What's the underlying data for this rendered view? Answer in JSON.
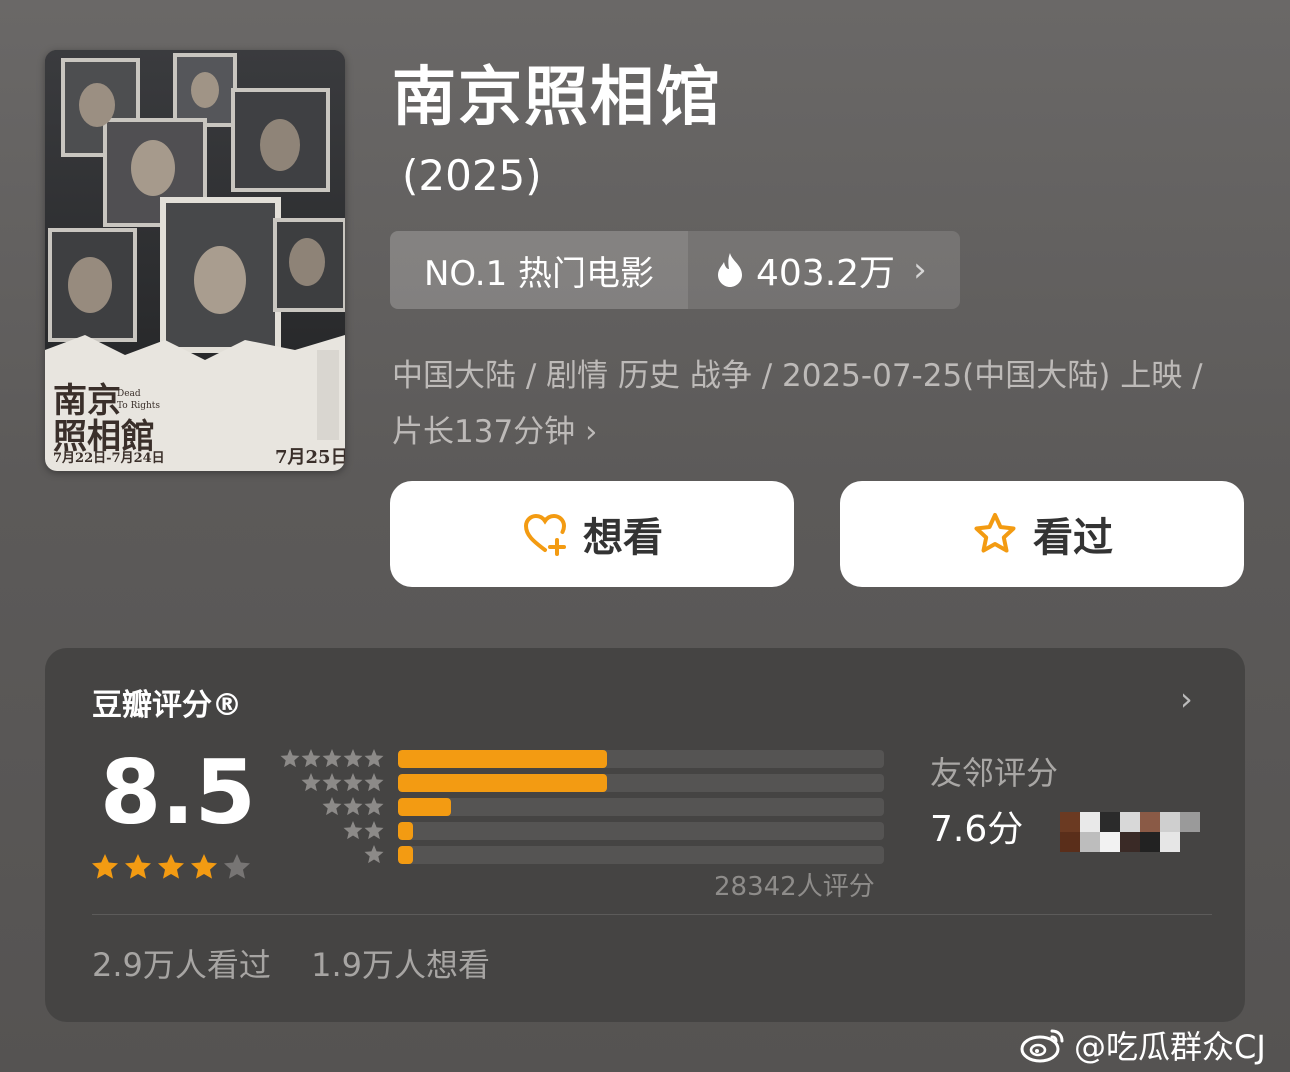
{
  "movie": {
    "title": "南京照相馆",
    "year": "(2025)",
    "rank_label": "NO.1 热门电影",
    "heat": "403.2万",
    "meta_line1": "中国大陆 / 剧情 历史 战争 / 2025-07-25(中国大陆) 上映 /",
    "meta_line2": "片长137分钟",
    "poster": {
      "title_text": "南京照相館",
      "eng_text": "Dead To Rights",
      "dates": "7月22日-7月24日",
      "release": "7月25日"
    }
  },
  "buttons": {
    "want": "想看",
    "watched": "看过"
  },
  "rating": {
    "title": "豆瓣评分®",
    "score": "8.5",
    "stars_value": 4.5,
    "distribution_pct": [
      43,
      43,
      11,
      3,
      3
    ],
    "count_text": "28342人评分",
    "friends_label": "友邻评分",
    "friends_score": "7.6分",
    "watched_count": "2.9万人看过",
    "want_count": "1.9万人想看"
  },
  "colors": {
    "accent": "#f39b12",
    "card_bg": "#454443",
    "page_bg": "#605e5d"
  },
  "watermark": "@吃瓜群众CJ"
}
